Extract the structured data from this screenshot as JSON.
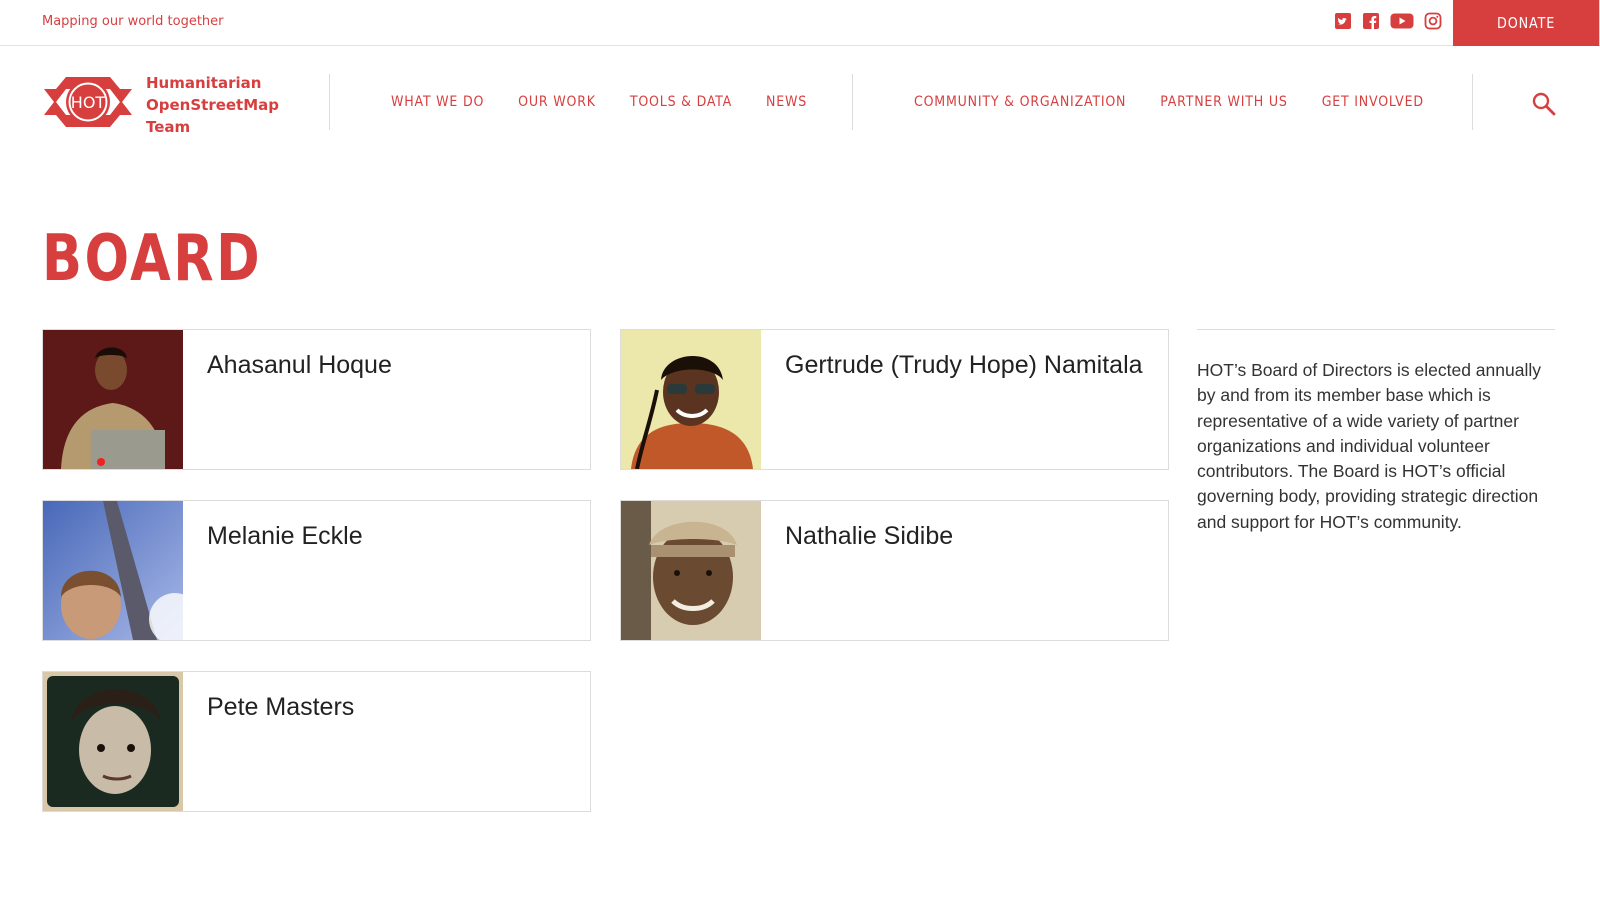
{
  "topbar": {
    "tagline": "Mapping our world together",
    "socials": [
      "twitter-icon",
      "facebook-icon",
      "youtube-icon",
      "instagram-icon"
    ],
    "donate_label": "DONATE"
  },
  "brand": {
    "logo_text": "HOT",
    "name_line1": "Humanitarian",
    "name_line2": "OpenStreetMap",
    "name_line3": "Team",
    "color": "#d73f3f"
  },
  "nav": {
    "primary": [
      "WHAT WE DO",
      "OUR WORK",
      "TOOLS & DATA",
      "NEWS"
    ],
    "secondary": [
      "COMMUNITY & ORGANIZATION",
      "PARTNER WITH US",
      "GET INVOLVED"
    ]
  },
  "page": {
    "title": "BOARD",
    "members": [
      {
        "name": "Ahasanul Hoque"
      },
      {
        "name": "Gertrude (Trudy Hope) Namitala"
      },
      {
        "name": "Melanie Eckle"
      },
      {
        "name": "Nathalie Sidibe"
      },
      {
        "name": "Pete Masters"
      }
    ],
    "description": "HOT’s Board of Directors is elected annually by and from its member base which is representative of a wide variety of partner organizations and individual volunteer contributors. The Board is HOT’s official governing body, providing strategic direction and support for HOT’s community."
  }
}
